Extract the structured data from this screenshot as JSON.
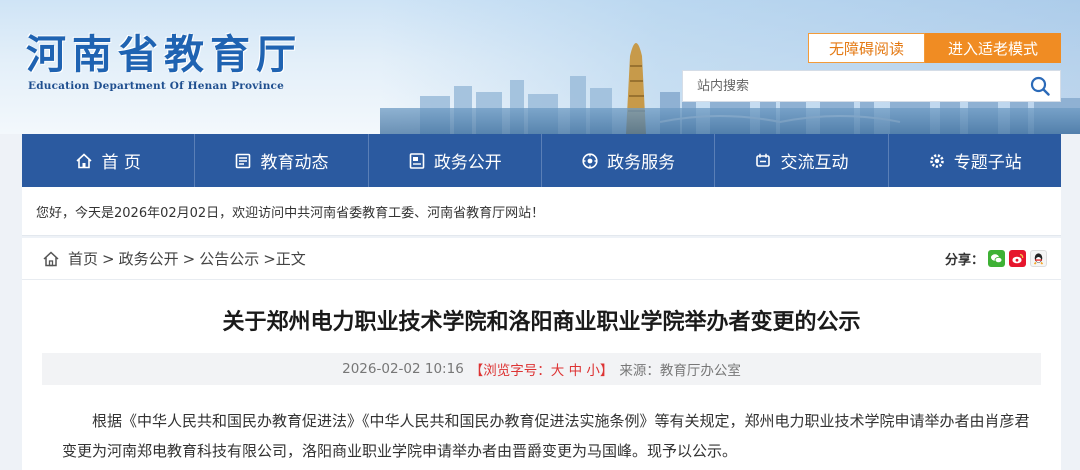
{
  "header": {
    "title_cn": "河南省教育厅",
    "title_en": "Education Department Of Henan Province",
    "btn_accessible": "无障碍阅读",
    "btn_elderly": "进入适老模式",
    "search_placeholder": "站内搜索"
  },
  "nav": {
    "items": [
      {
        "label": "首 页",
        "icon": "home-icon"
      },
      {
        "label": "教育动态",
        "icon": "news-icon"
      },
      {
        "label": "政务公开",
        "icon": "document-icon"
      },
      {
        "label": "政务服务",
        "icon": "service-icon"
      },
      {
        "label": "交流互动",
        "icon": "interaction-icon"
      },
      {
        "label": "专题子站",
        "icon": "gear-icon"
      }
    ]
  },
  "welcome": "您好，今天是2026年02月02日，欢迎访问中共河南省委教育工委、河南省教育厅网站！",
  "breadcrumb": {
    "items": [
      "首页",
      "政务公开",
      "公告公示"
    ],
    "sep": ">",
    "current": ">正文"
  },
  "share": {
    "label": "分享："
  },
  "article": {
    "title": "关于郑州电力职业技术学院和洛阳商业职业学院举办者变更的公示",
    "datetime": "2026-02-02 10:16",
    "fontsize_prefix": "【浏览字号：",
    "fontsize_large": "大",
    "fontsize_medium": "中",
    "fontsize_small": "小",
    "fontsize_suffix": "】",
    "source": "来源：教育厅办公室",
    "body": "根据《中华人民共和国民办教育促进法》《中华人民共和国民办教育促进法实施条例》等有关规定，郑州电力职业技术学院申请举办者由肖彦君变更为河南郑电教育科技有限公司，洛阳商业职业学院申请举办者由晋爵变更为马国峰。现予以公示。"
  },
  "colors": {
    "nav_bg": "#2b5aa0",
    "logo_blue": "#1f63b2",
    "orange": "#f08c23",
    "fontsize_red": "#d33"
  }
}
